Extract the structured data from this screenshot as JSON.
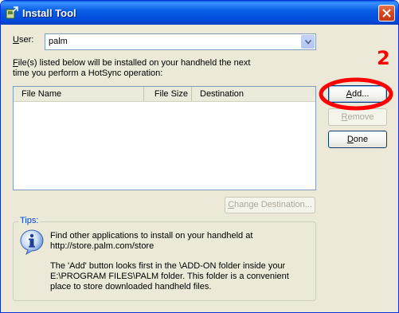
{
  "window": {
    "title": "Install Tool"
  },
  "user": {
    "label_accel": "U",
    "label_rest": "ser:",
    "value": "palm"
  },
  "description": {
    "line1_accel": "F",
    "line1_rest": "ile(s) listed below will be installed on your handheld the next",
    "line2": "time you perform a HotSync operation:"
  },
  "listview": {
    "columns": [
      "File Name",
      "File Size",
      "Destination"
    ]
  },
  "buttons": {
    "add": {
      "accel": "A",
      "rest": "dd..."
    },
    "remove": {
      "accel": "R",
      "rest": "emove"
    },
    "done": {
      "accel": "D",
      "rest": "one"
    },
    "change_destination": {
      "accel": "C",
      "rest": "hange Destination..."
    }
  },
  "tips": {
    "title": "Tips:",
    "lines": [
      "Find other applications to install on your handheld at",
      "http://store.palm.com/store",
      "",
      "The 'Add' button looks first in the \\ADD-ON folder inside your",
      "E:\\PROGRAM FILES\\PALM folder. This folder is a convenient",
      "place to store downloaded handheld files."
    ]
  },
  "annotation": {
    "number": "2",
    "color": "#ff0000"
  },
  "colors": {
    "titlebar": "#0b5ee6",
    "dialog": "#ece9d8",
    "tips_title": "#0046d5"
  }
}
